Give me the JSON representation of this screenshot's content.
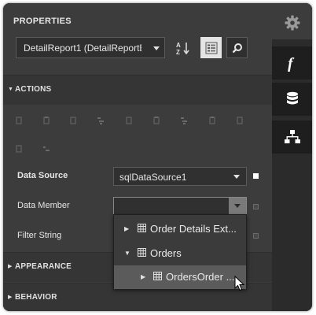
{
  "header": {
    "title": "PROPERTIES"
  },
  "toolbar": {
    "report_selector": "DetailReport1 (DetailReportB...",
    "buttons": [
      "sort-az-icon",
      "categorized-view-icon",
      "search-icon"
    ]
  },
  "rail": {
    "items": [
      "gear-icon",
      "function-icon",
      "database-icon",
      "hierarchy-icon"
    ]
  },
  "sections": {
    "actions": "ACTIONS",
    "appearance": "APPEARANCE",
    "behavior": "BEHAVIOR"
  },
  "properties": {
    "data_source": {
      "label": "Data Source",
      "value": "sqlDataSource1"
    },
    "data_member": {
      "label": "Data Member",
      "value": ""
    },
    "filter_string": {
      "label": "Filter String"
    }
  },
  "dropdown": {
    "items": [
      {
        "label": "Order Details Ext...",
        "expanded": false
      },
      {
        "label": "Orders",
        "expanded": true
      },
      {
        "label": "OrdersOrder ...",
        "expanded": false,
        "selected": true
      }
    ]
  },
  "colors": {
    "panel": "#3c3c3c",
    "rail": "#2b2b2b",
    "accent": "#ffffff"
  }
}
